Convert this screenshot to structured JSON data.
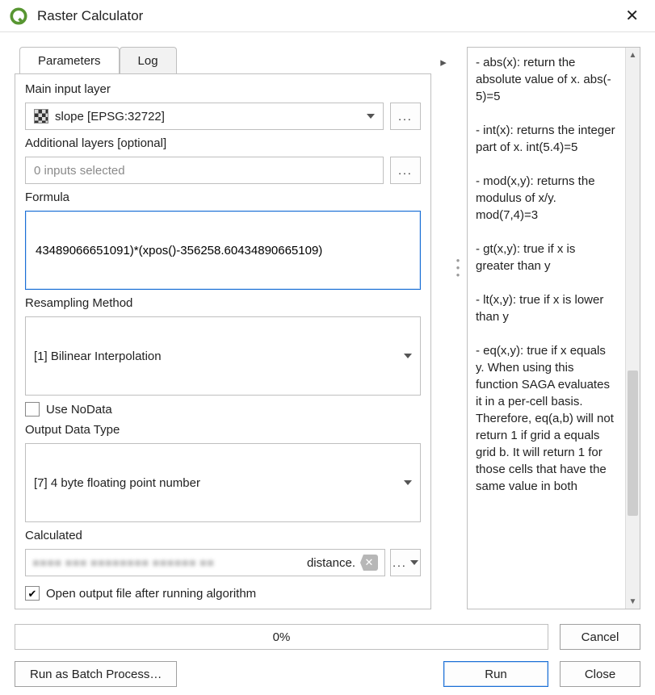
{
  "window": {
    "title": "Raster Calculator"
  },
  "tabs": {
    "parameters": "Parameters",
    "log": "Log"
  },
  "labels": {
    "main_input_layer": "Main input layer",
    "additional_layers": "Additional layers [optional]",
    "formula": "Formula",
    "resampling_method": "Resampling Method",
    "use_nodata": "Use NoData",
    "output_data_type": "Output Data Type",
    "calculated": "Calculated",
    "open_after": "Open output file after running algorithm"
  },
  "values": {
    "main_input_layer": "slope [EPSG:32722]",
    "additional_layers": "0 inputs selected",
    "formula": "43489066651091)*(xpos()-356258.60434890665109)",
    "resampling_method": "[1] Bilinear Interpolation",
    "output_data_type": "[7] 4 byte floating point number",
    "calculated_suffix": "distance.",
    "use_nodata_checked": false,
    "open_after_checked": true
  },
  "buttons": {
    "browse": "...",
    "cancel": "Cancel",
    "run_batch": "Run as Batch Process…",
    "run": "Run",
    "close": "Close"
  },
  "progress": {
    "text": "0%"
  },
  "help": {
    "text": "- abs(x): return the absolute value of x. abs(- 5)=5\n\n- int(x): returns the integer part of x. int(5.4)=5\n\n- mod(x,y): returns the modulus of x/y. mod(7,4)=3\n\n- gt(x,y): true if x is greater than y\n\n- lt(x,y): true if x is lower than y\n\n- eq(x,y): true if x equals y. When using this function SAGA evaluates it in a per-cell basis. Therefore, eq(a,b) will not return 1 if grid a equals grid b. It will return 1 for those cells that have the same value in both"
  }
}
